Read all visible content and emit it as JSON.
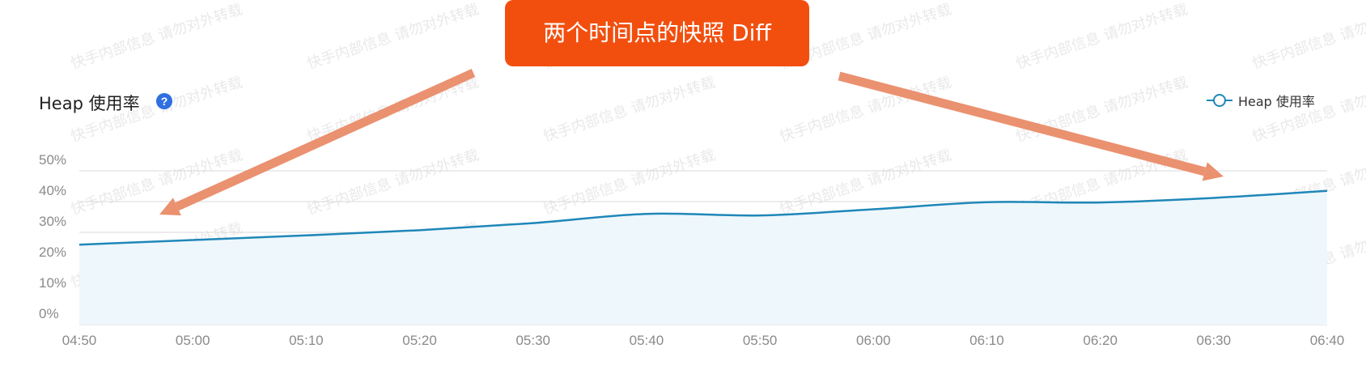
{
  "title": "Heap 使用率",
  "help_icon": "?",
  "callout": "两个时间点的快照 Diff",
  "legend": {
    "label": "Heap 使用率",
    "icon": "line-circle-icon"
  },
  "watermark": "快手内部信息 请勿对外转载",
  "colors": {
    "line": "#1f87b8",
    "area": "#eef7fc",
    "grid": "#d9d9d9",
    "arrow": "#ea9170",
    "callout_bg": "#f24f0f",
    "help_icon": "#2f6fe0"
  },
  "chart_data": {
    "type": "area",
    "title": "Heap 使用率",
    "xlabel": "",
    "ylabel": "",
    "x": [
      "04:50",
      "05:00",
      "05:10",
      "05:20",
      "05:30",
      "05:40",
      "05:50",
      "06:00",
      "06:10",
      "06:20",
      "06:30",
      "06:40"
    ],
    "yticks": [
      "0%",
      "10%",
      "20%",
      "30%",
      "40%",
      "50%"
    ],
    "ylim": [
      0,
      50
    ],
    "series": [
      {
        "name": "Heap 使用率",
        "values": [
          26,
          27.5,
          29,
          30.7,
          33,
          36,
          35.5,
          37.5,
          39.8,
          39.7,
          41.2,
          43.5
        ]
      }
    ],
    "grid": true,
    "legend_position": "top-right",
    "annotations": [
      {
        "text": "两个时间点的快照 Diff",
        "points_to": [
          "04:57",
          "06:30"
        ]
      }
    ]
  }
}
